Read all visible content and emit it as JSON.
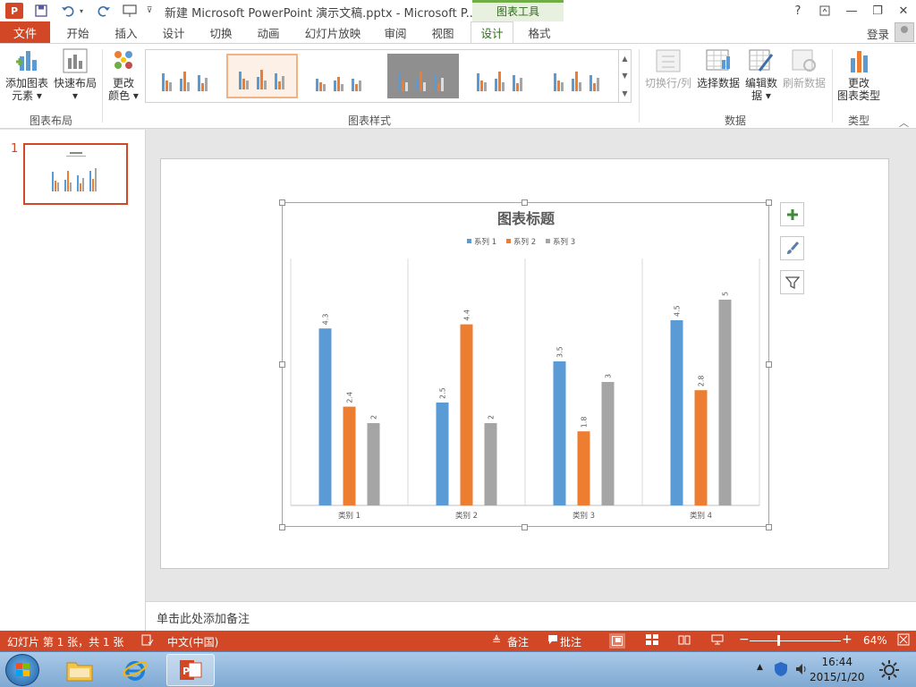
{
  "window": {
    "app_logo": "P",
    "title": "新建 Microsoft PowerPoint 演示文稿.pptx - Microsoft P...",
    "context_tab": "图表工具",
    "help": "?",
    "minimize": "—",
    "restore": "❐",
    "close": "✕"
  },
  "tabs": {
    "file": "文件",
    "items": [
      "开始",
      "插入",
      "设计",
      "切换",
      "动画",
      "幻灯片放映",
      "审阅",
      "视图",
      "设计",
      "格式"
    ],
    "active_index": 8,
    "login": "登录"
  },
  "ribbon": {
    "add_element": "添加图表\n元素",
    "add_element_l1": "添加图表",
    "add_element_l2": "元素 ▾",
    "quick_layout": "快速布局",
    "quick_layout_arrow": "▾",
    "group_layout": "图表布局",
    "change_color_l1": "更改",
    "change_color_l2": "颜色 ▾",
    "group_styles": "图表样式",
    "switch_row_col": "切换行/列",
    "select_data": "选择数据",
    "edit_data_l1": "编辑数",
    "edit_data_l2": "据 ▾",
    "refresh_data": "刷新数据",
    "group_data": "数据",
    "change_type_l1": "更改",
    "change_type_l2": "图表类型",
    "group_type": "类型"
  },
  "thumbnails": {
    "slide_number": "1"
  },
  "notes": {
    "placeholder": "单击此处添加备注"
  },
  "statusbar": {
    "slide_info": "幻灯片 第 1 张，共 1 张",
    "language": "中文(中国)",
    "notes": "备注",
    "comments": "批注",
    "zoom": "64%",
    "zoom_level": 0.64
  },
  "taskbar": {
    "time": "16:44",
    "date": "2015/1/20"
  },
  "colors": {
    "accent": "#d24726",
    "series1": "#5b9bd5",
    "series2": "#ed7d31",
    "series3": "#a5a5a5",
    "context_green": "#70ad47"
  },
  "chart_data": {
    "type": "bar",
    "title": "图表标题",
    "categories": [
      "类别 1",
      "类别 2",
      "类别 3",
      "类别 4"
    ],
    "series": [
      {
        "name": "系列 1",
        "values": [
          4.3,
          2.5,
          3.5,
          4.5
        ],
        "color": "#5b9bd5"
      },
      {
        "name": "系列 2",
        "values": [
          2.4,
          4.4,
          1.8,
          2.8
        ],
        "color": "#ed7d31"
      },
      {
        "name": "系列 3",
        "values": [
          2,
          2,
          3,
          5
        ],
        "color": "#a5a5a5"
      }
    ],
    "ylim": [
      0,
      6
    ],
    "grid": "vertical-category-separators",
    "legend": "top",
    "data_labels": true
  }
}
